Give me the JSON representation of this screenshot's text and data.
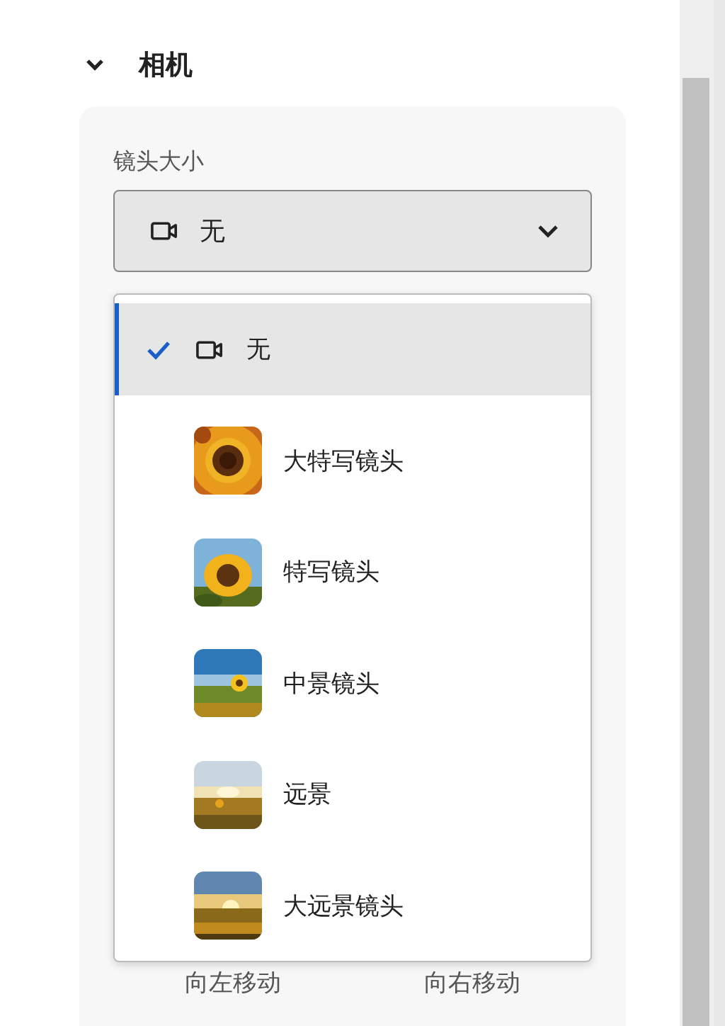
{
  "section": {
    "title": "相机",
    "expanded": true
  },
  "field": {
    "label": "镜头大小",
    "value": "无",
    "open": true
  },
  "menu": {
    "options": [
      {
        "label": "无",
        "kind": "none",
        "selected": true
      },
      {
        "label": "大特写镜头",
        "kind": "picture",
        "selected": false
      },
      {
        "label": "特写镜头",
        "kind": "picture",
        "selected": false
      },
      {
        "label": "中景镜头",
        "kind": "picture",
        "selected": false
      },
      {
        "label": "远景",
        "kind": "picture",
        "selected": false
      },
      {
        "label": "大远景镜头",
        "kind": "picture",
        "selected": false
      }
    ]
  },
  "buttons": [
    "向左移动",
    "向右移动"
  ]
}
